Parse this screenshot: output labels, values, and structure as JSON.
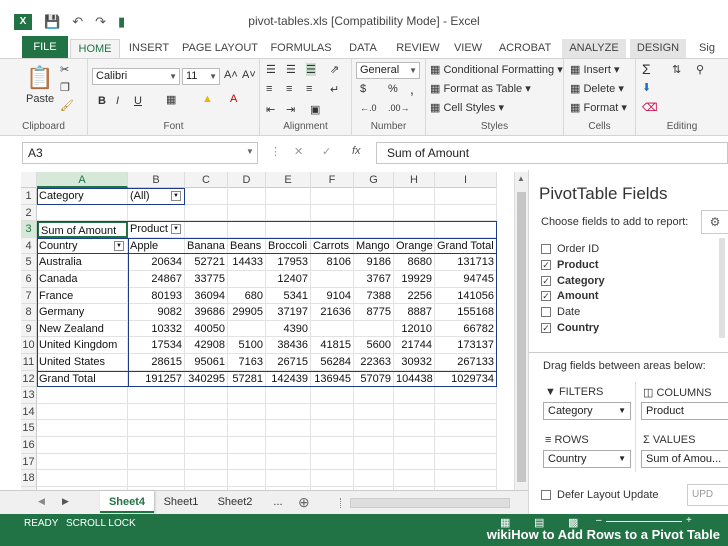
{
  "window": {
    "title": "pivot-tables.xls  [Compatibility Mode] - Excel"
  },
  "tabs": [
    "FILE",
    "HOME",
    "INSERT",
    "PAGE LAYOUT",
    "FORMULAS",
    "DATA",
    "REVIEW",
    "VIEW",
    "ACROBAT",
    "ANALYZE",
    "DESIGN",
    "Sig"
  ],
  "ribbon": {
    "clipboard": {
      "label": "Clipboard",
      "paste": "Paste"
    },
    "font": {
      "label": "Font",
      "name": "Calibri",
      "size": "11",
      "bold": "B",
      "italic": "I",
      "underline": "U",
      "grow": "A˄",
      "shrink": "A˅"
    },
    "alignment": {
      "label": "Alignment"
    },
    "number": {
      "label": "Number",
      "format": "General",
      "currency": "$",
      "percent": "%",
      "comma": ","
    },
    "styles": {
      "label": "Styles",
      "conditional": "Conditional Formatting",
      "format_table": "Format as Table",
      "cell_styles": "Cell Styles"
    },
    "cells": {
      "label": "Cells",
      "insert": "Insert",
      "delete": "Delete",
      "format": "Format"
    },
    "editing": {
      "label": "Editing"
    }
  },
  "formula_bar": {
    "name_box": "A3",
    "formula": "Sum of Amount",
    "fx": "fx"
  },
  "columns": [
    "A",
    "B",
    "C",
    "D",
    "E",
    "F",
    "G",
    "H",
    "I"
  ],
  "rows": [
    "1",
    "2",
    "3",
    "4",
    "5",
    "6",
    "7",
    "8",
    "9",
    "10",
    "11",
    "12",
    "13",
    "14",
    "15",
    "16",
    "17",
    "18",
    "19"
  ],
  "pivot": {
    "filter_label": "Category",
    "filter_value": "(All)",
    "values_label": "Sum of Amount",
    "col_label": "Product",
    "row_label": "Country",
    "headers": [
      "Apple",
      "Banana",
      "Beans",
      "Broccoli",
      "Carrots",
      "Mango",
      "Orange",
      "Grand Total"
    ],
    "data": [
      [
        "Australia",
        "20634",
        "52721",
        "14433",
        "17953",
        "8106",
        "9186",
        "8680",
        "131713"
      ],
      [
        "Canada",
        "24867",
        "33775",
        "",
        "12407",
        "",
        "3767",
        "19929",
        "94745"
      ],
      [
        "France",
        "80193",
        "36094",
        "680",
        "5341",
        "9104",
        "7388",
        "2256",
        "141056"
      ],
      [
        "Germany",
        "9082",
        "39686",
        "29905",
        "37197",
        "21636",
        "8775",
        "8887",
        "155168"
      ],
      [
        "New Zealand",
        "10332",
        "40050",
        "",
        "4390",
        "",
        "",
        "12010",
        "66782"
      ],
      [
        "United Kingdom",
        "17534",
        "42908",
        "5100",
        "38436",
        "41815",
        "5600",
        "21744",
        "173137"
      ],
      [
        "United States",
        "28615",
        "95061",
        "7163",
        "26715",
        "56284",
        "22363",
        "30932",
        "267133"
      ]
    ],
    "grand_total": [
      "Grand Total",
      "191257",
      "340295",
      "57281",
      "142439",
      "136945",
      "57079",
      "104438",
      "1029734"
    ]
  },
  "sheets": [
    "Sheet4",
    "Sheet1",
    "Sheet2",
    "..."
  ],
  "status": {
    "ready": "READY",
    "scroll_lock": "SCROLL LOCK"
  },
  "pivot_pane": {
    "title": "PivotTable Fields",
    "subtitle": "Choose fields to add to report:",
    "fields": [
      {
        "name": "Order ID",
        "checked": false
      },
      {
        "name": "Product",
        "checked": true
      },
      {
        "name": "Category",
        "checked": true
      },
      {
        "name": "Amount",
        "checked": true
      },
      {
        "name": "Date",
        "checked": false
      },
      {
        "name": "Country",
        "checked": true
      }
    ],
    "drag_hint": "Drag fields between areas below:",
    "filters_label": "FILTERS",
    "filters_value": "Category",
    "columns_label": "COLUMNS",
    "columns_value": "Product",
    "rows_label": "ROWS",
    "rows_value": "Country",
    "values_label": "VALUES",
    "values_value": "Sum of Amou...",
    "defer": "Defer Layout Update",
    "update": "UPD"
  },
  "watermark": "wikiHow to Add Rows to a Pivot Table"
}
